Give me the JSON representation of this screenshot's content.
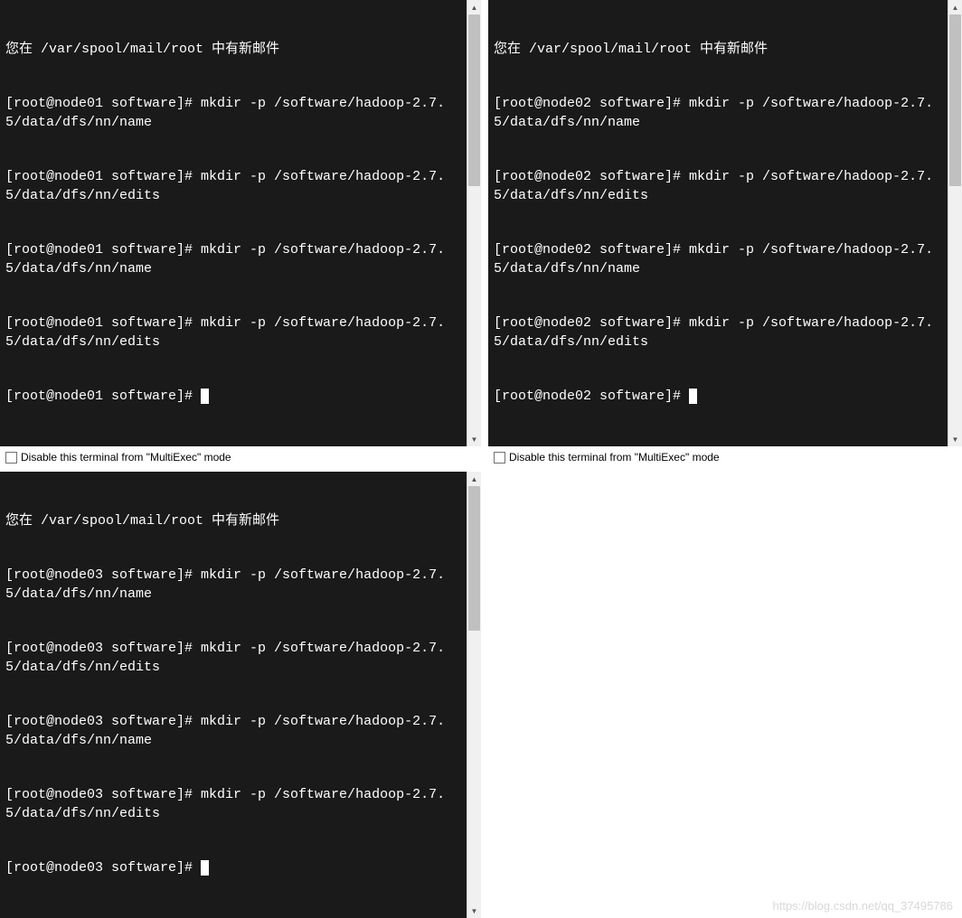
{
  "terminals": {
    "top_left": {
      "node": "node01",
      "lines": [
        "您在 /var/spool/mail/root 中有新邮件",
        "[root@node01 software]# mkdir -p /software/hadoop-2.7.5/data/dfs/nn/name",
        "[root@node01 software]# mkdir -p /software/hadoop-2.7.5/data/dfs/nn/edits",
        "[root@node01 software]# mkdir -p /software/hadoop-2.7.5/data/dfs/nn/name",
        "[root@node01 software]# mkdir -p /software/hadoop-2.7.5/data/dfs/nn/edits",
        "[root@node01 software]# "
      ]
    },
    "top_right": {
      "node": "node02",
      "lines": [
        "您在 /var/spool/mail/root 中有新邮件",
        "[root@node02 software]# mkdir -p /software/hadoop-2.7.5/data/dfs/nn/name",
        "[root@node02 software]# mkdir -p /software/hadoop-2.7.5/data/dfs/nn/edits",
        "[root@node02 software]# mkdir -p /software/hadoop-2.7.5/data/dfs/nn/name",
        "[root@node02 software]# mkdir -p /software/hadoop-2.7.5/data/dfs/nn/edits",
        "[root@node02 software]# "
      ]
    },
    "bottom_left": {
      "node": "node03",
      "lines": [
        "您在 /var/spool/mail/root 中有新邮件",
        "[root@node03 software]# mkdir -p /software/hadoop-2.7.5/data/dfs/nn/name",
        "[root@node03 software]# mkdir -p /software/hadoop-2.7.5/data/dfs/nn/edits",
        "[root@node03 software]# mkdir -p /software/hadoop-2.7.5/data/dfs/nn/name",
        "[root@node03 software]# mkdir -p /software/hadoop-2.7.5/data/dfs/nn/edits",
        "[root@node03 software]# "
      ]
    }
  },
  "footer": {
    "disable_label": "Disable this terminal from \"MultiExec\" mode"
  },
  "watermark": "https://blog.csdn.net/qq_37495786",
  "scrollbar": {
    "up_glyph": "▲",
    "down_glyph": "▼"
  }
}
